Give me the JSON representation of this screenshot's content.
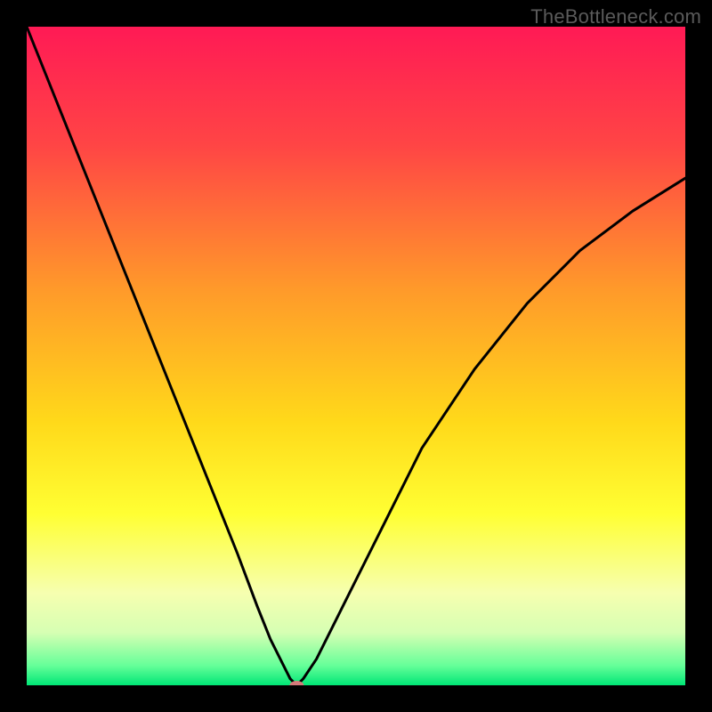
{
  "watermark": "TheBottleneck.com",
  "chart_data": {
    "type": "line",
    "title": "",
    "xlabel": "",
    "ylabel": "",
    "xlim": [
      0,
      100
    ],
    "ylim": [
      0,
      100
    ],
    "grid": false,
    "background_gradient": {
      "stops": [
        {
          "pos": 0.0,
          "color": "#ff1a55"
        },
        {
          "pos": 0.18,
          "color": "#ff4545"
        },
        {
          "pos": 0.4,
          "color": "#ff9a2a"
        },
        {
          "pos": 0.6,
          "color": "#ffd91a"
        },
        {
          "pos": 0.74,
          "color": "#ffff33"
        },
        {
          "pos": 0.86,
          "color": "#f6ffb0"
        },
        {
          "pos": 0.92,
          "color": "#d6ffb3"
        },
        {
          "pos": 0.97,
          "color": "#66ff99"
        },
        {
          "pos": 1.0,
          "color": "#00e676"
        }
      ]
    },
    "series": [
      {
        "name": "bottleneck-curve",
        "x": [
          0,
          4,
          8,
          12,
          16,
          20,
          24,
          28,
          32,
          35,
          37,
          39,
          40,
          41,
          42,
          44,
          48,
          54,
          60,
          68,
          76,
          84,
          92,
          100
        ],
        "y": [
          100,
          90,
          80,
          70,
          60,
          50,
          40,
          30,
          20,
          12,
          7,
          3,
          1,
          0,
          1,
          4,
          12,
          24,
          36,
          48,
          58,
          66,
          72,
          77
        ]
      }
    ],
    "marker": {
      "name": "optimal-point",
      "x": 41,
      "y": 0,
      "color": "#d47a7a",
      "rx": 8,
      "ry": 5
    }
  }
}
